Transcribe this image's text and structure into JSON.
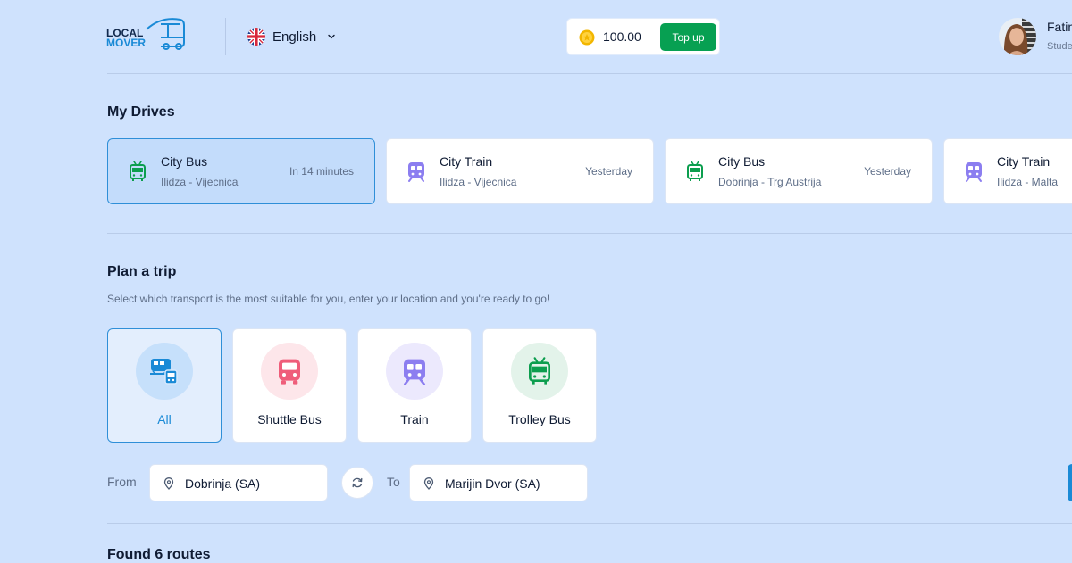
{
  "header": {
    "logo": {
      "line1": "LOCAL",
      "line2": "MOVER"
    },
    "language": {
      "label": "English",
      "icon": "uk-flag-icon"
    },
    "wallet": {
      "balance": "100.00",
      "topup_label": "Top up",
      "coin_icon": "coin-icon"
    },
    "user": {
      "name": "Fatim",
      "role": "Stude"
    }
  },
  "colors": {
    "accent": "#1a8ad6",
    "green": "#07a052",
    "train": "#8c7ef0",
    "trolley": "#0c9e4e",
    "shuttle": "#ef5d7a",
    "background": "#cfe2fd"
  },
  "drives": {
    "title": "My Drives",
    "items": [
      {
        "title": "City Bus",
        "route": "Ilidza - Vijecnica",
        "when": "In 14 minutes",
        "icon": "trolley-bus-icon",
        "active": true
      },
      {
        "title": "City Train",
        "route": "Ilidza - Vijecnica",
        "when": "Yesterday",
        "icon": "train-icon",
        "active": false
      },
      {
        "title": "City Bus",
        "route": "Dobrinja - Trg Austrija",
        "when": "Yesterday",
        "icon": "trolley-bus-icon",
        "active": false
      },
      {
        "title": "City Train",
        "route": "Ilidza - Malta",
        "when": "",
        "icon": "train-icon",
        "active": false
      }
    ]
  },
  "plan": {
    "title": "Plan a trip",
    "subtitle": "Select which transport is the most suitable for you, enter your location and you're ready to go!",
    "transports": [
      {
        "label": "All",
        "icon": "all-transport-icon",
        "active": true
      },
      {
        "label": "Shuttle Bus",
        "icon": "shuttle-bus-icon",
        "active": false
      },
      {
        "label": "Train",
        "icon": "train-icon",
        "active": false
      },
      {
        "label": "Trolley Bus",
        "icon": "trolley-bus-icon",
        "active": false
      }
    ],
    "from_label": "From",
    "from_value": "Dobrinja (SA)",
    "to_label": "To",
    "to_value": "Marijin Dvor (SA)",
    "swap_icon": "swap-icon",
    "pin_icon": "location-pin-icon"
  },
  "results": {
    "title": "Found 6 routes"
  }
}
